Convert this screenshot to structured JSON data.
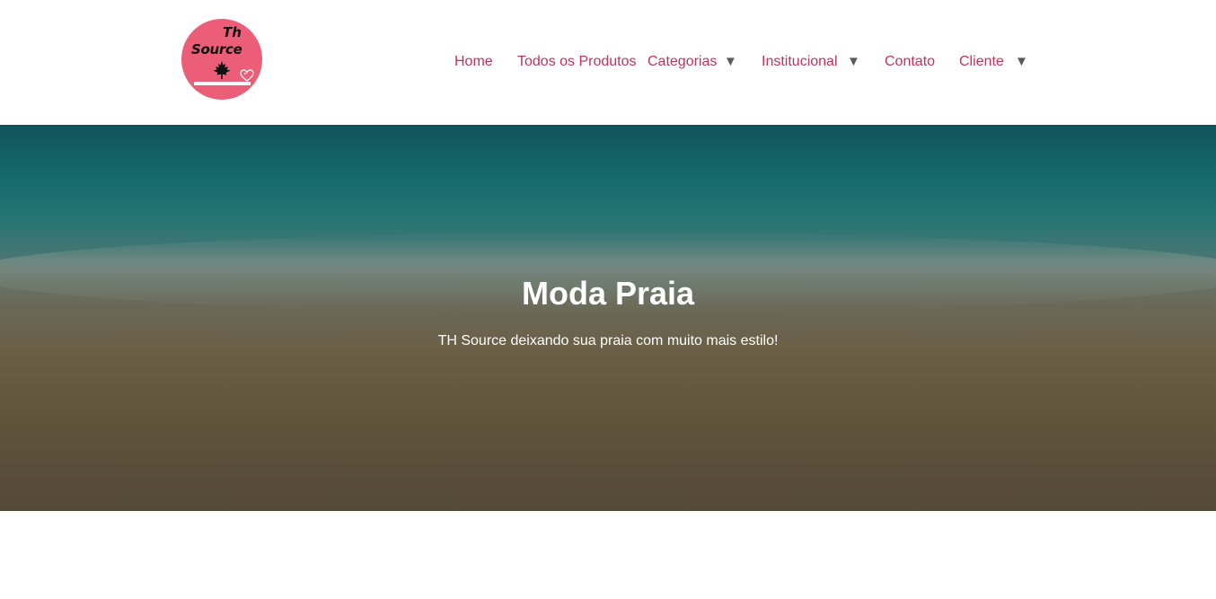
{
  "logo": {
    "line1": "Th",
    "line2": "Source"
  },
  "nav": {
    "items": [
      {
        "label": "Home",
        "has_dropdown": false
      },
      {
        "label": "Todos os Produtos",
        "has_dropdown": false
      },
      {
        "label": "Categorias",
        "has_dropdown": true
      },
      {
        "label": "Institucional",
        "has_dropdown": true
      },
      {
        "label": "Contato",
        "has_dropdown": false
      },
      {
        "label": "Cliente",
        "has_dropdown": true
      }
    ],
    "caret_glyph": "▼",
    "link_color": "#c0335a"
  },
  "hero": {
    "title": "Moda Praia",
    "subtitle": "TH Source deixando sua praia com muito mais estilo!"
  },
  "colors": {
    "brand_pink": "#ec5e78",
    "nav_text": "#c0335a"
  }
}
